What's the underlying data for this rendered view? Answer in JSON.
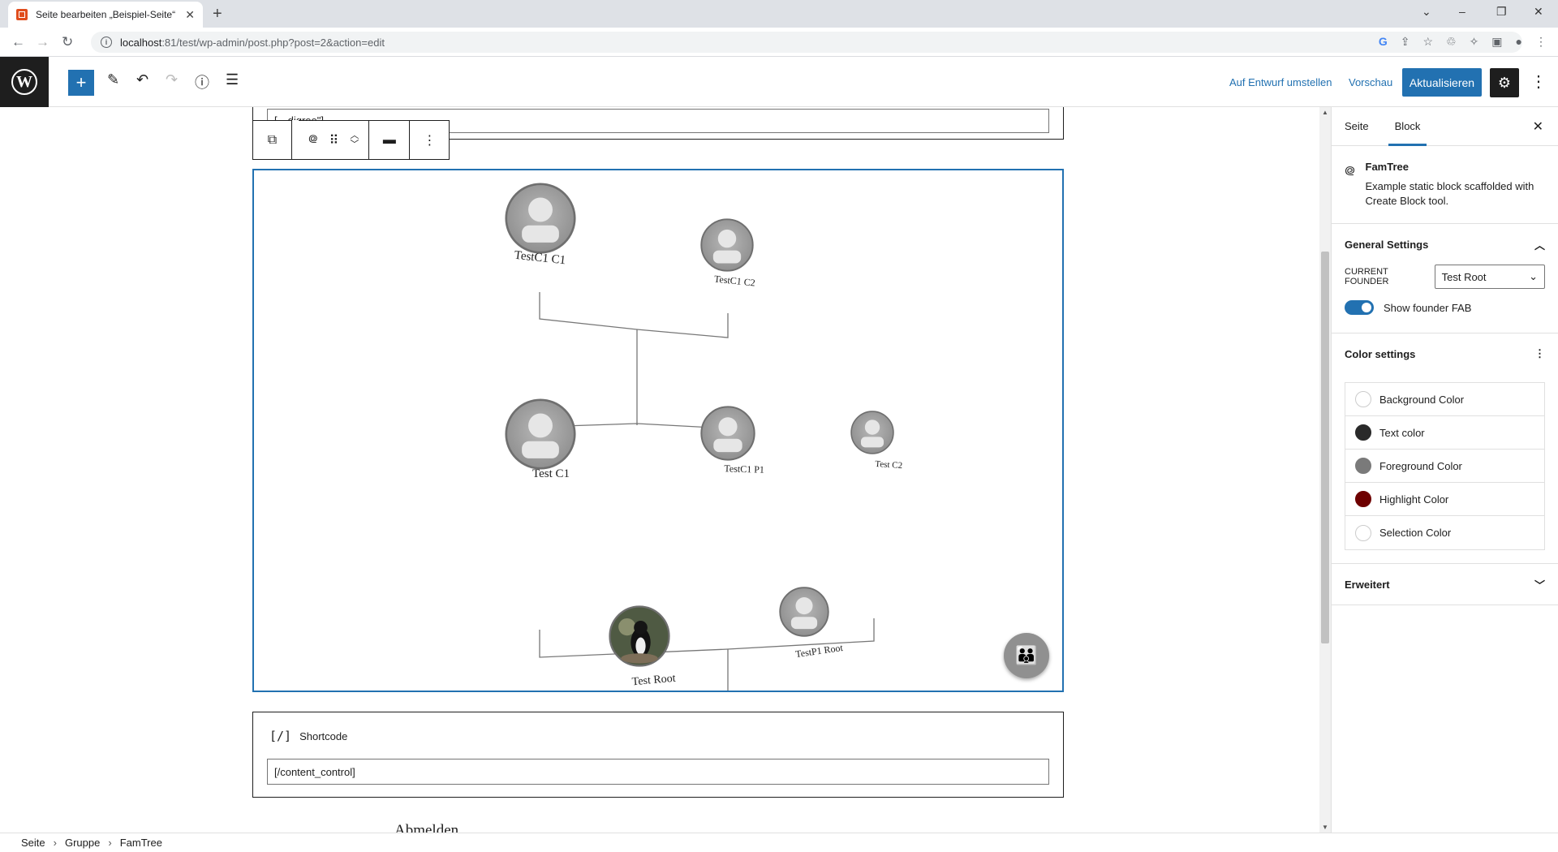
{
  "browser": {
    "tab_title": "Seite bearbeiten „Beispiel-Seite“",
    "tab_close": "✕",
    "new_tab": "+",
    "url_host": "localhost",
    "url_path": ":81/test/wp-admin/post.php?post=2&action=edit",
    "window_controls": [
      "⌄",
      "–",
      "❐",
      "✕"
    ]
  },
  "toolbar": {
    "logo": "W",
    "add_label": "+",
    "draft_label": "Auf Entwurf umstellen",
    "preview_label": "Vorschau",
    "update_label": "Aktualisieren",
    "settings_icon": "⚙",
    "more_icon": "⋮"
  },
  "editor": {
    "prev_block_text": "[…digree\"]",
    "famtree": {
      "nodes": [
        {
          "label": "TestC1 C1"
        },
        {
          "label": "TestC1 C2"
        },
        {
          "label": "Test C1"
        },
        {
          "label": "TestC1 P1"
        },
        {
          "label": "Test C2"
        },
        {
          "label": "Test Root"
        },
        {
          "label": "TestP1 Root"
        }
      ]
    },
    "shortcode": {
      "icon": "[/]",
      "title": "Shortcode",
      "value": "[/content_control]"
    },
    "abmelden": "Abmelden"
  },
  "breadcrumb": [
    "Seite",
    "Gruppe",
    "FamTree"
  ],
  "sidebar": {
    "tabs": [
      "Seite",
      "Block"
    ],
    "active_tab": "Block",
    "close": "✕",
    "block": {
      "name": "FamTree",
      "description": "Example static block scaffolded with Create Block tool."
    },
    "general_settings": {
      "title": "General Settings",
      "founder_label": "CURRENT FOUNDER",
      "founder_value": "Test Root",
      "show_fab_label": "Show founder FAB",
      "show_fab_on": true
    },
    "color_settings": {
      "title": "Color settings",
      "items": [
        {
          "label": "Background Color",
          "color": "#ffffff"
        },
        {
          "label": "Text color",
          "color": "#2a2a2a"
        },
        {
          "label": "Foreground Color",
          "color": "#7a7a7a"
        },
        {
          "label": "Highlight Color",
          "color": "#6e0000"
        },
        {
          "label": "Selection Color",
          "color": "#ffffff"
        }
      ]
    },
    "advanced": {
      "title": "Erweitert"
    }
  }
}
